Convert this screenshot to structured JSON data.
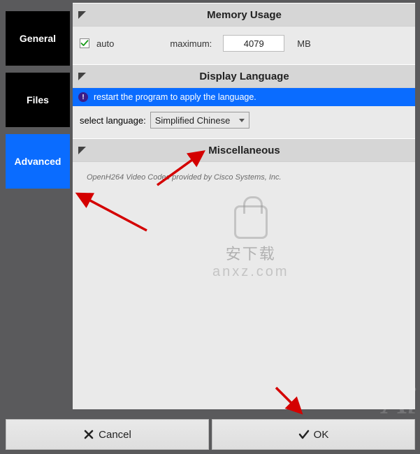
{
  "sidebar": {
    "tabs": [
      {
        "id": "general",
        "label": "General",
        "active": false
      },
      {
        "id": "files",
        "label": "Files",
        "active": false
      },
      {
        "id": "advanced",
        "label": "Advanced",
        "active": true
      }
    ]
  },
  "sections": {
    "memory": {
      "title": "Memory Usage",
      "auto_checked": true,
      "auto_label": "auto",
      "max_label": "maximum:",
      "max_value": "4079",
      "unit": "MB"
    },
    "language": {
      "title": "Display Language",
      "info_text": "restart the program to apply the language.",
      "select_label": "select language:",
      "selected": "Simplified Chinese"
    },
    "misc": {
      "title": "Miscellaneous",
      "codec_note": "OpenH264 Video Codec provided by Cisco Systems, Inc."
    }
  },
  "footer": {
    "cancel": "Cancel",
    "ok": "OK"
  },
  "watermark": {
    "cn": "安下载",
    "domain": "anxz.com"
  },
  "bg_text": "Ai"
}
